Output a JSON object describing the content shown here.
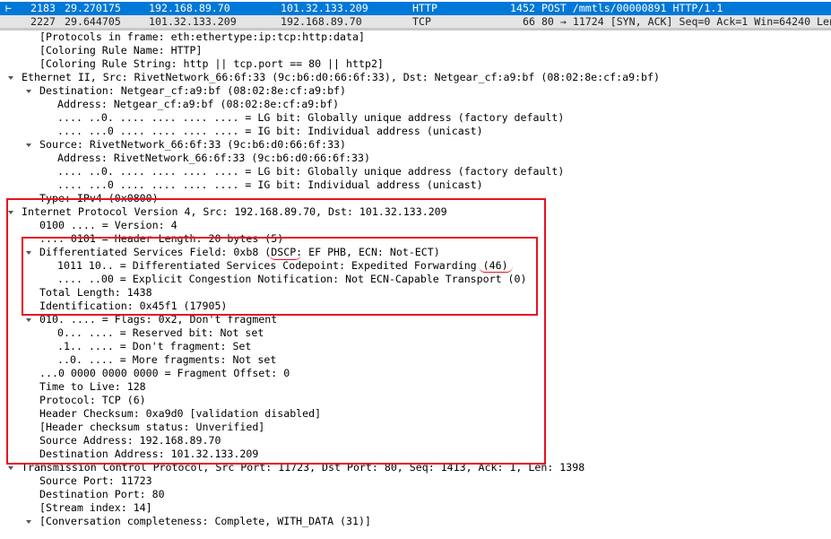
{
  "packet_list": {
    "rows": [
      {
        "no": "2183",
        "time": "29.270175",
        "source": "192.168.89.70",
        "destination": "101.32.133.209",
        "protocol": "HTTP",
        "info": "1452 POST /mmtls/00000891 HTTP/1.1",
        "state": "selected"
      },
      {
        "no": "2227",
        "time": "29.644705",
        "source": "101.32.133.209",
        "destination": "192.168.89.70",
        "protocol": "TCP",
        "info": "66 80 → 11724 [SYN, ACK] Seq=0 Ack=1 Win=64240 Len",
        "state": "gray"
      }
    ]
  },
  "details": [
    {
      "depth": 1,
      "toggle": "none",
      "text": "[Protocols in frame: eth:ethertype:ip:tcp:http:data]"
    },
    {
      "depth": 1,
      "toggle": "none",
      "text": "[Coloring Rule Name: HTTP]"
    },
    {
      "depth": 1,
      "toggle": "none",
      "text": "[Coloring Rule String: http || tcp.port == 80 || http2]"
    },
    {
      "depth": 0,
      "toggle": "open",
      "text": "Ethernet II, Src: RivetNetwork_66:6f:33 (9c:b6:d0:66:6f:33), Dst: Netgear_cf:a9:bf (08:02:8e:cf:a9:bf)"
    },
    {
      "depth": 1,
      "toggle": "open",
      "text": "Destination: Netgear_cf:a9:bf (08:02:8e:cf:a9:bf)"
    },
    {
      "depth": 2,
      "toggle": "none",
      "text": "Address: Netgear_cf:a9:bf (08:02:8e:cf:a9:bf)"
    },
    {
      "depth": 2,
      "toggle": "none",
      "text": ".... ..0. .... .... .... .... = LG bit: Globally unique address (factory default)"
    },
    {
      "depth": 2,
      "toggle": "none",
      "text": ".... ...0 .... .... .... .... = IG bit: Individual address (unicast)"
    },
    {
      "depth": 1,
      "toggle": "open",
      "text": "Source: RivetNetwork_66:6f:33 (9c:b6:d0:66:6f:33)"
    },
    {
      "depth": 2,
      "toggle": "none",
      "text": "Address: RivetNetwork_66:6f:33 (9c:b6:d0:66:6f:33)"
    },
    {
      "depth": 2,
      "toggle": "none",
      "text": ".... ..0. .... .... .... .... = LG bit: Globally unique address (factory default)"
    },
    {
      "depth": 2,
      "toggle": "none",
      "text": ".... ...0 .... .... .... .... = IG bit: Individual address (unicast)"
    },
    {
      "depth": 1,
      "toggle": "none",
      "text": "Type: IPv4 (0x0800)"
    },
    {
      "depth": 0,
      "toggle": "open",
      "text": "Internet Protocol Version 4, Src: 192.168.89.70, Dst: 101.32.133.209"
    },
    {
      "depth": 1,
      "toggle": "none",
      "text": "0100 .... = Version: 4"
    },
    {
      "depth": 1,
      "toggle": "none",
      "text": ".... 0101 = Header Length: 20 bytes (5)"
    },
    {
      "depth": 1,
      "toggle": "open",
      "text": "Differentiated Services Field: 0xb8 (DSCP: EF PHB, ECN: Not-ECT)"
    },
    {
      "depth": 2,
      "toggle": "none",
      "text": "1011 10.. = Differentiated Services Codepoint: Expedited Forwarding (46)"
    },
    {
      "depth": 2,
      "toggle": "none",
      "text": ".... ..00 = Explicit Congestion Notification: Not ECN-Capable Transport (0)"
    },
    {
      "depth": 1,
      "toggle": "none",
      "text": "Total Length: 1438"
    },
    {
      "depth": 1,
      "toggle": "none",
      "text": "Identification: 0x45f1 (17905)"
    },
    {
      "depth": 1,
      "toggle": "open",
      "text": "010. .... = Flags: 0x2, Don't fragment"
    },
    {
      "depth": 2,
      "toggle": "none",
      "text": "0... .... = Reserved bit: Not set"
    },
    {
      "depth": 2,
      "toggle": "none",
      "text": ".1.. .... = Don't fragment: Set"
    },
    {
      "depth": 2,
      "toggle": "none",
      "text": "..0. .... = More fragments: Not set"
    },
    {
      "depth": 1,
      "toggle": "none",
      "text": "...0 0000 0000 0000 = Fragment Offset: 0"
    },
    {
      "depth": 1,
      "toggle": "none",
      "text": "Time to Live: 128"
    },
    {
      "depth": 1,
      "toggle": "none",
      "text": "Protocol: TCP (6)"
    },
    {
      "depth": 1,
      "toggle": "none",
      "text": "Header Checksum: 0xa9d0 [validation disabled]"
    },
    {
      "depth": 1,
      "toggle": "none",
      "text": "[Header checksum status: Unverified]"
    },
    {
      "depth": 1,
      "toggle": "none",
      "text": "Source Address: 192.168.89.70"
    },
    {
      "depth": 1,
      "toggle": "none",
      "text": "Destination Address: 101.32.133.209"
    },
    {
      "depth": 0,
      "toggle": "open",
      "text": "Transmission Control Protocol, Src Port: 11723, Dst Port: 80, Seq: 1413, Ack: 1, Len: 1398"
    },
    {
      "depth": 1,
      "toggle": "none",
      "text": "Source Port: 11723"
    },
    {
      "depth": 1,
      "toggle": "none",
      "text": "Destination Port: 80"
    },
    {
      "depth": 1,
      "toggle": "none",
      "text": "[Stream index: 14]"
    },
    {
      "depth": 1,
      "toggle": "open",
      "text": "[Conversation completeness: Complete, WITH_DATA (31)]"
    }
  ],
  "colors": {
    "annotation": "#e81123",
    "selected_row": "#0078d7",
    "arrow": "#555555"
  }
}
